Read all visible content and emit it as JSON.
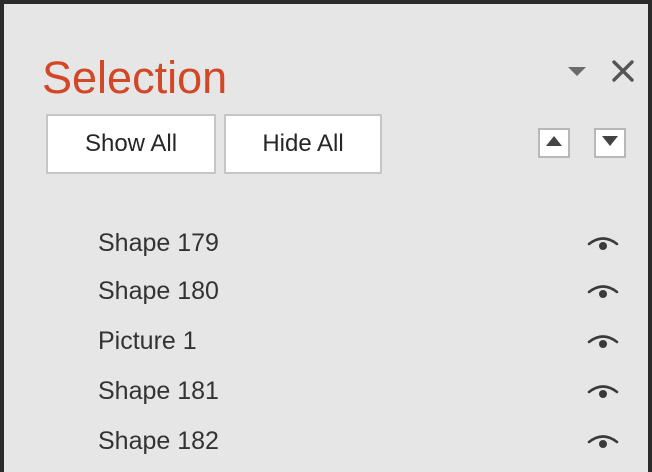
{
  "pane": {
    "title": "Selection",
    "pane_options_icon": "dropdown-arrow-icon",
    "close_icon": "close-icon",
    "title_color": "#d24726"
  },
  "toolbar": {
    "show_all_label": "Show All",
    "hide_all_label": "Hide All",
    "bring_forward_icon": "triangle-up-icon",
    "send_backward_icon": "triangle-down-icon"
  },
  "items": [
    {
      "label": "Shape 179",
      "visibility_icon": "eye-icon"
    },
    {
      "label": "Shape 180",
      "visibility_icon": "eye-icon"
    },
    {
      "label": "Picture 1",
      "visibility_icon": "eye-icon"
    },
    {
      "label": "Shape 181",
      "visibility_icon": "eye-icon"
    },
    {
      "label": "Shape 182",
      "visibility_icon": "eye-icon"
    }
  ]
}
